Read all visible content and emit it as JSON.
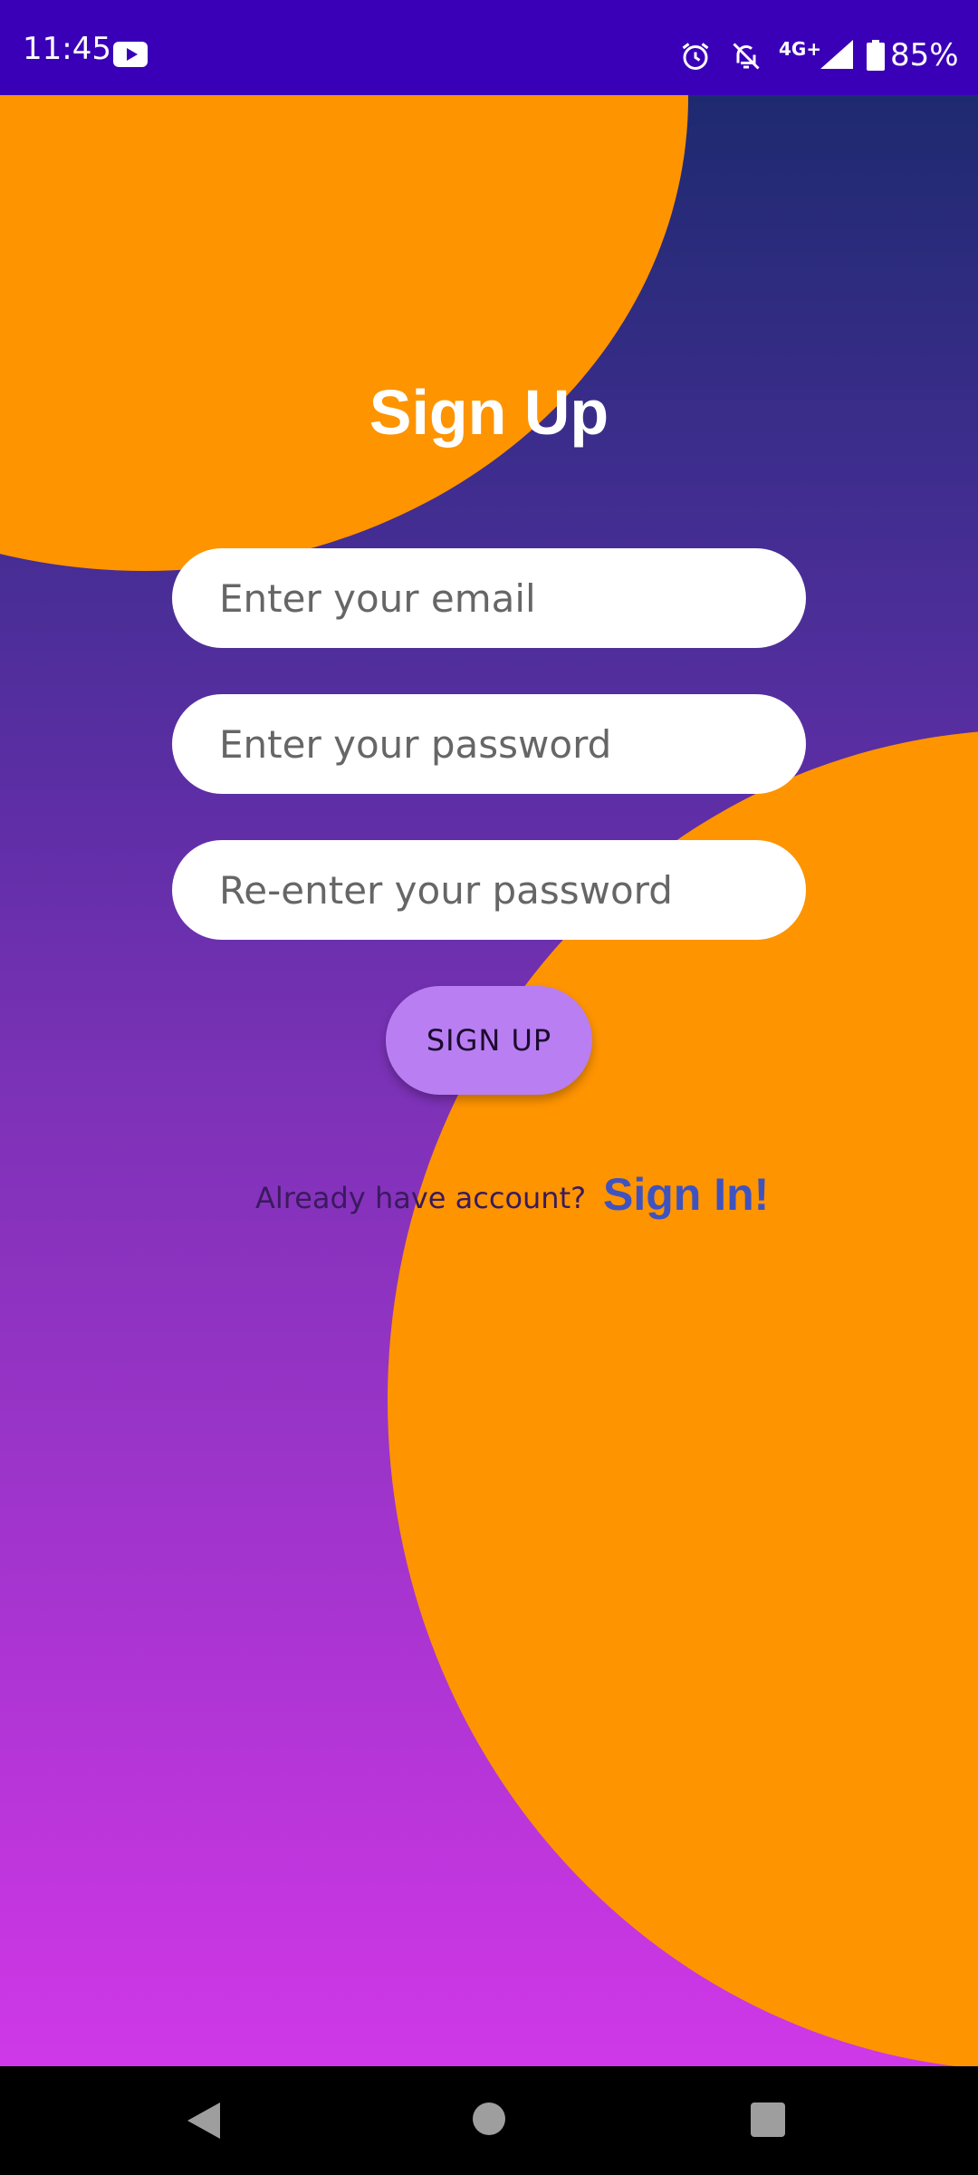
{
  "status_bar": {
    "time": "11:45",
    "network": "4G+",
    "battery": "85%",
    "icons": [
      "youtube-icon",
      "alarm-icon",
      "bell-off-icon",
      "signal-icon",
      "battery-icon"
    ]
  },
  "page": {
    "title": "Sign Up"
  },
  "form": {
    "email_placeholder": "Enter your email",
    "email_value": "",
    "password_placeholder": "Enter your password",
    "password_value": "",
    "confirm_placeholder": "Re-enter your password",
    "confirm_value": "",
    "submit_label": "SIGN UP"
  },
  "footer": {
    "prompt": "Already have account?",
    "signin_link": "Sign In!"
  },
  "nav_bar": {
    "icons": [
      "back-icon",
      "home-icon",
      "recents-icon"
    ]
  },
  "colors": {
    "status_bar": "#3a00b8",
    "accent_orange": "#fe9400",
    "gradient_top": "#1e2a70",
    "gradient_bottom": "#ce38e8",
    "button": "#b97ef2",
    "link": "#3f53c0"
  }
}
